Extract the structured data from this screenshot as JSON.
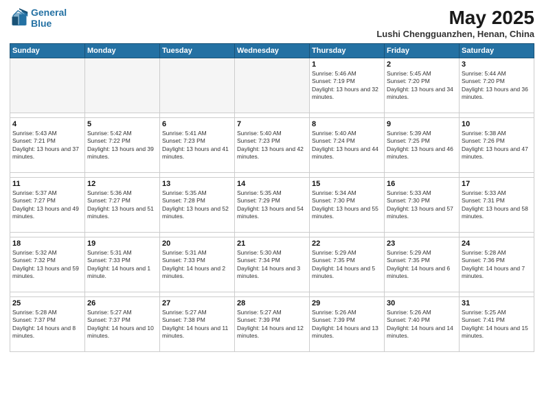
{
  "header": {
    "logo_line1": "General",
    "logo_line2": "Blue",
    "title": "May 2025",
    "subtitle": "Lushi Chengguanzhen, Henan, China"
  },
  "days_of_week": [
    "Sunday",
    "Monday",
    "Tuesday",
    "Wednesday",
    "Thursday",
    "Friday",
    "Saturday"
  ],
  "weeks": [
    [
      {
        "day": "",
        "empty": true
      },
      {
        "day": "",
        "empty": true
      },
      {
        "day": "",
        "empty": true
      },
      {
        "day": "",
        "empty": true
      },
      {
        "day": "1",
        "sunrise": "5:46 AM",
        "sunset": "7:19 PM",
        "daylight": "13 hours and 32 minutes."
      },
      {
        "day": "2",
        "sunrise": "5:45 AM",
        "sunset": "7:20 PM",
        "daylight": "13 hours and 34 minutes."
      },
      {
        "day": "3",
        "sunrise": "5:44 AM",
        "sunset": "7:20 PM",
        "daylight": "13 hours and 36 minutes."
      }
    ],
    [
      {
        "day": "4",
        "sunrise": "5:43 AM",
        "sunset": "7:21 PM",
        "daylight": "13 hours and 37 minutes."
      },
      {
        "day": "5",
        "sunrise": "5:42 AM",
        "sunset": "7:22 PM",
        "daylight": "13 hours and 39 minutes."
      },
      {
        "day": "6",
        "sunrise": "5:41 AM",
        "sunset": "7:23 PM",
        "daylight": "13 hours and 41 minutes."
      },
      {
        "day": "7",
        "sunrise": "5:40 AM",
        "sunset": "7:23 PM",
        "daylight": "13 hours and 42 minutes."
      },
      {
        "day": "8",
        "sunrise": "5:40 AM",
        "sunset": "7:24 PM",
        "daylight": "13 hours and 44 minutes."
      },
      {
        "day": "9",
        "sunrise": "5:39 AM",
        "sunset": "7:25 PM",
        "daylight": "13 hours and 46 minutes."
      },
      {
        "day": "10",
        "sunrise": "5:38 AM",
        "sunset": "7:26 PM",
        "daylight": "13 hours and 47 minutes."
      }
    ],
    [
      {
        "day": "11",
        "sunrise": "5:37 AM",
        "sunset": "7:27 PM",
        "daylight": "13 hours and 49 minutes."
      },
      {
        "day": "12",
        "sunrise": "5:36 AM",
        "sunset": "7:27 PM",
        "daylight": "13 hours and 51 minutes."
      },
      {
        "day": "13",
        "sunrise": "5:35 AM",
        "sunset": "7:28 PM",
        "daylight": "13 hours and 52 minutes."
      },
      {
        "day": "14",
        "sunrise": "5:35 AM",
        "sunset": "7:29 PM",
        "daylight": "13 hours and 54 minutes."
      },
      {
        "day": "15",
        "sunrise": "5:34 AM",
        "sunset": "7:30 PM",
        "daylight": "13 hours and 55 minutes."
      },
      {
        "day": "16",
        "sunrise": "5:33 AM",
        "sunset": "7:30 PM",
        "daylight": "13 hours and 57 minutes."
      },
      {
        "day": "17",
        "sunrise": "5:33 AM",
        "sunset": "7:31 PM",
        "daylight": "13 hours and 58 minutes."
      }
    ],
    [
      {
        "day": "18",
        "sunrise": "5:32 AM",
        "sunset": "7:32 PM",
        "daylight": "13 hours and 59 minutes."
      },
      {
        "day": "19",
        "sunrise": "5:31 AM",
        "sunset": "7:33 PM",
        "daylight": "14 hours and 1 minute."
      },
      {
        "day": "20",
        "sunrise": "5:31 AM",
        "sunset": "7:33 PM",
        "daylight": "14 hours and 2 minutes."
      },
      {
        "day": "21",
        "sunrise": "5:30 AM",
        "sunset": "7:34 PM",
        "daylight": "14 hours and 3 minutes."
      },
      {
        "day": "22",
        "sunrise": "5:29 AM",
        "sunset": "7:35 PM",
        "daylight": "14 hours and 5 minutes."
      },
      {
        "day": "23",
        "sunrise": "5:29 AM",
        "sunset": "7:35 PM",
        "daylight": "14 hours and 6 minutes."
      },
      {
        "day": "24",
        "sunrise": "5:28 AM",
        "sunset": "7:36 PM",
        "daylight": "14 hours and 7 minutes."
      }
    ],
    [
      {
        "day": "25",
        "sunrise": "5:28 AM",
        "sunset": "7:37 PM",
        "daylight": "14 hours and 8 minutes."
      },
      {
        "day": "26",
        "sunrise": "5:27 AM",
        "sunset": "7:37 PM",
        "daylight": "14 hours and 10 minutes."
      },
      {
        "day": "27",
        "sunrise": "5:27 AM",
        "sunset": "7:38 PM",
        "daylight": "14 hours and 11 minutes."
      },
      {
        "day": "28",
        "sunrise": "5:27 AM",
        "sunset": "7:39 PM",
        "daylight": "14 hours and 12 minutes."
      },
      {
        "day": "29",
        "sunrise": "5:26 AM",
        "sunset": "7:39 PM",
        "daylight": "14 hours and 13 minutes."
      },
      {
        "day": "30",
        "sunrise": "5:26 AM",
        "sunset": "7:40 PM",
        "daylight": "14 hours and 14 minutes."
      },
      {
        "day": "31",
        "sunrise": "5:25 AM",
        "sunset": "7:41 PM",
        "daylight": "14 hours and 15 minutes."
      }
    ]
  ],
  "labels": {
    "sunrise": "Sunrise:",
    "sunset": "Sunset:",
    "daylight": "Daylight:"
  }
}
